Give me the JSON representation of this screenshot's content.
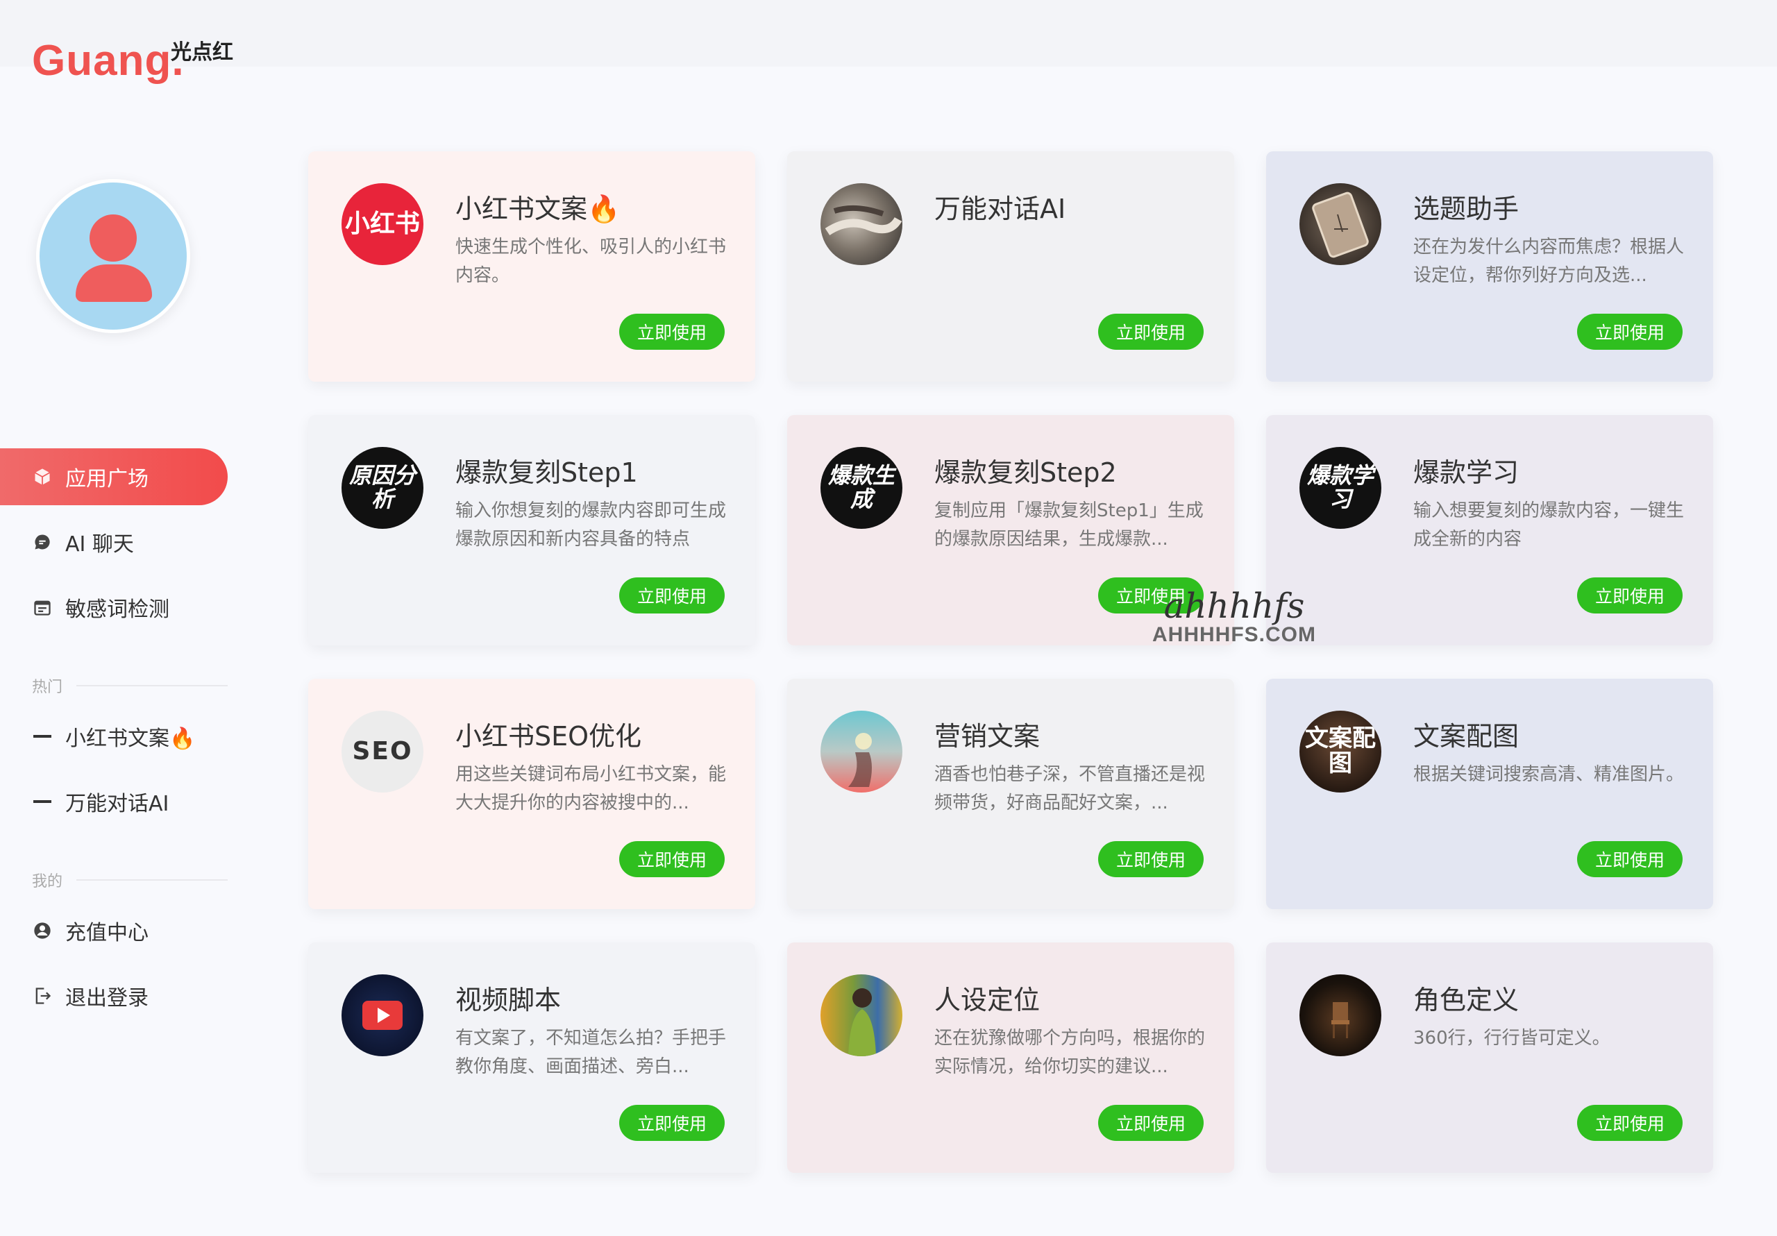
{
  "brand": {
    "logo": "Guang.",
    "name": "光点红",
    "accent": "#ef5350"
  },
  "sidebar": {
    "main": [
      {
        "label": "应用广场",
        "icon": "cube-icon",
        "active": true
      },
      {
        "label": "AI 聊天",
        "icon": "chat-bubble-icon"
      },
      {
        "label": "敏感词检测",
        "icon": "calendar-icon"
      }
    ],
    "hot_label": "热门",
    "hot": [
      {
        "label": "小红书文案🔥"
      },
      {
        "label": "万能对话AI"
      }
    ],
    "mine_label": "我的",
    "mine": [
      {
        "label": "充值中心",
        "icon": "user-circle-icon"
      },
      {
        "label": "退出登录",
        "icon": "logout-icon"
      }
    ]
  },
  "cards": [
    {
      "title": "小红书文案🔥",
      "desc": "快速生成个性化、吸引人的小红书内容。",
      "button": "立即使用",
      "thumb_text": "小红书",
      "bg": "#fdf2f1"
    },
    {
      "title": "万能对话AI",
      "desc": "",
      "button": "立即使用",
      "thumb_text": "",
      "bg": "#f1f1f3"
    },
    {
      "title": "选题助手",
      "desc": "还在为发什么内容而焦虑？根据人设定位，帮你列好方向及选...",
      "button": "立即使用",
      "thumb_text": "",
      "bg": "#e3e6f2"
    },
    {
      "title": "爆款复刻Step1",
      "desc": "输入你想复刻的爆款内容即可生成爆款原因和新内容具备的特点",
      "button": "立即使用",
      "thumb_text": "原因分析",
      "bg": "#f2f3f7"
    },
    {
      "title": "爆款复刻Step2",
      "desc": "复制应用「爆款复刻Step1」生成的爆款原因结果，生成爆款...",
      "button": "立即使用",
      "thumb_text": "爆款生成",
      "bg": "#f4e9ec"
    },
    {
      "title": "爆款学习",
      "desc": "输入想要复刻的爆款内容，一键生成全新的内容",
      "button": "立即使用",
      "thumb_text": "爆款学习",
      "bg": "#ece9f1"
    },
    {
      "title": "小红书SEO优化",
      "desc": "用这些关键词布局小红书文案，能大大提升你的内容被搜中的...",
      "button": "立即使用",
      "thumb_text": "SEO",
      "bg": "#fdf2f1"
    },
    {
      "title": "营销文案",
      "desc": "酒香也怕巷子深，不管直播还是视频带货，好商品配好文案，...",
      "button": "立即使用",
      "thumb_text": "",
      "bg": "#f1f1f3"
    },
    {
      "title": "文案配图",
      "desc": "根据关键词搜索高清、精准图片。",
      "button": "立即使用",
      "thumb_text": "文案配图",
      "bg": "#e3e6f2"
    },
    {
      "title": "视频脚本",
      "desc": "有文案了，不知道怎么拍？手把手教你角度、画面描述、旁白...",
      "button": "立即使用",
      "thumb_text": "",
      "bg": "#f2f3f7"
    },
    {
      "title": "人设定位",
      "desc": "还在犹豫做哪个方向吗，根据你的实际情况，给你切实的建议...",
      "button": "立即使用",
      "thumb_text": "",
      "bg": "#f4e9ec"
    },
    {
      "title": "角色定义",
      "desc": "360行，行行皆可定义。",
      "button": "立即使用",
      "thumb_text": "",
      "bg": "#ece9f1"
    }
  ],
  "watermark": {
    "script": "ahhhhfs",
    "domain": "AHHHHFS.COM"
  }
}
